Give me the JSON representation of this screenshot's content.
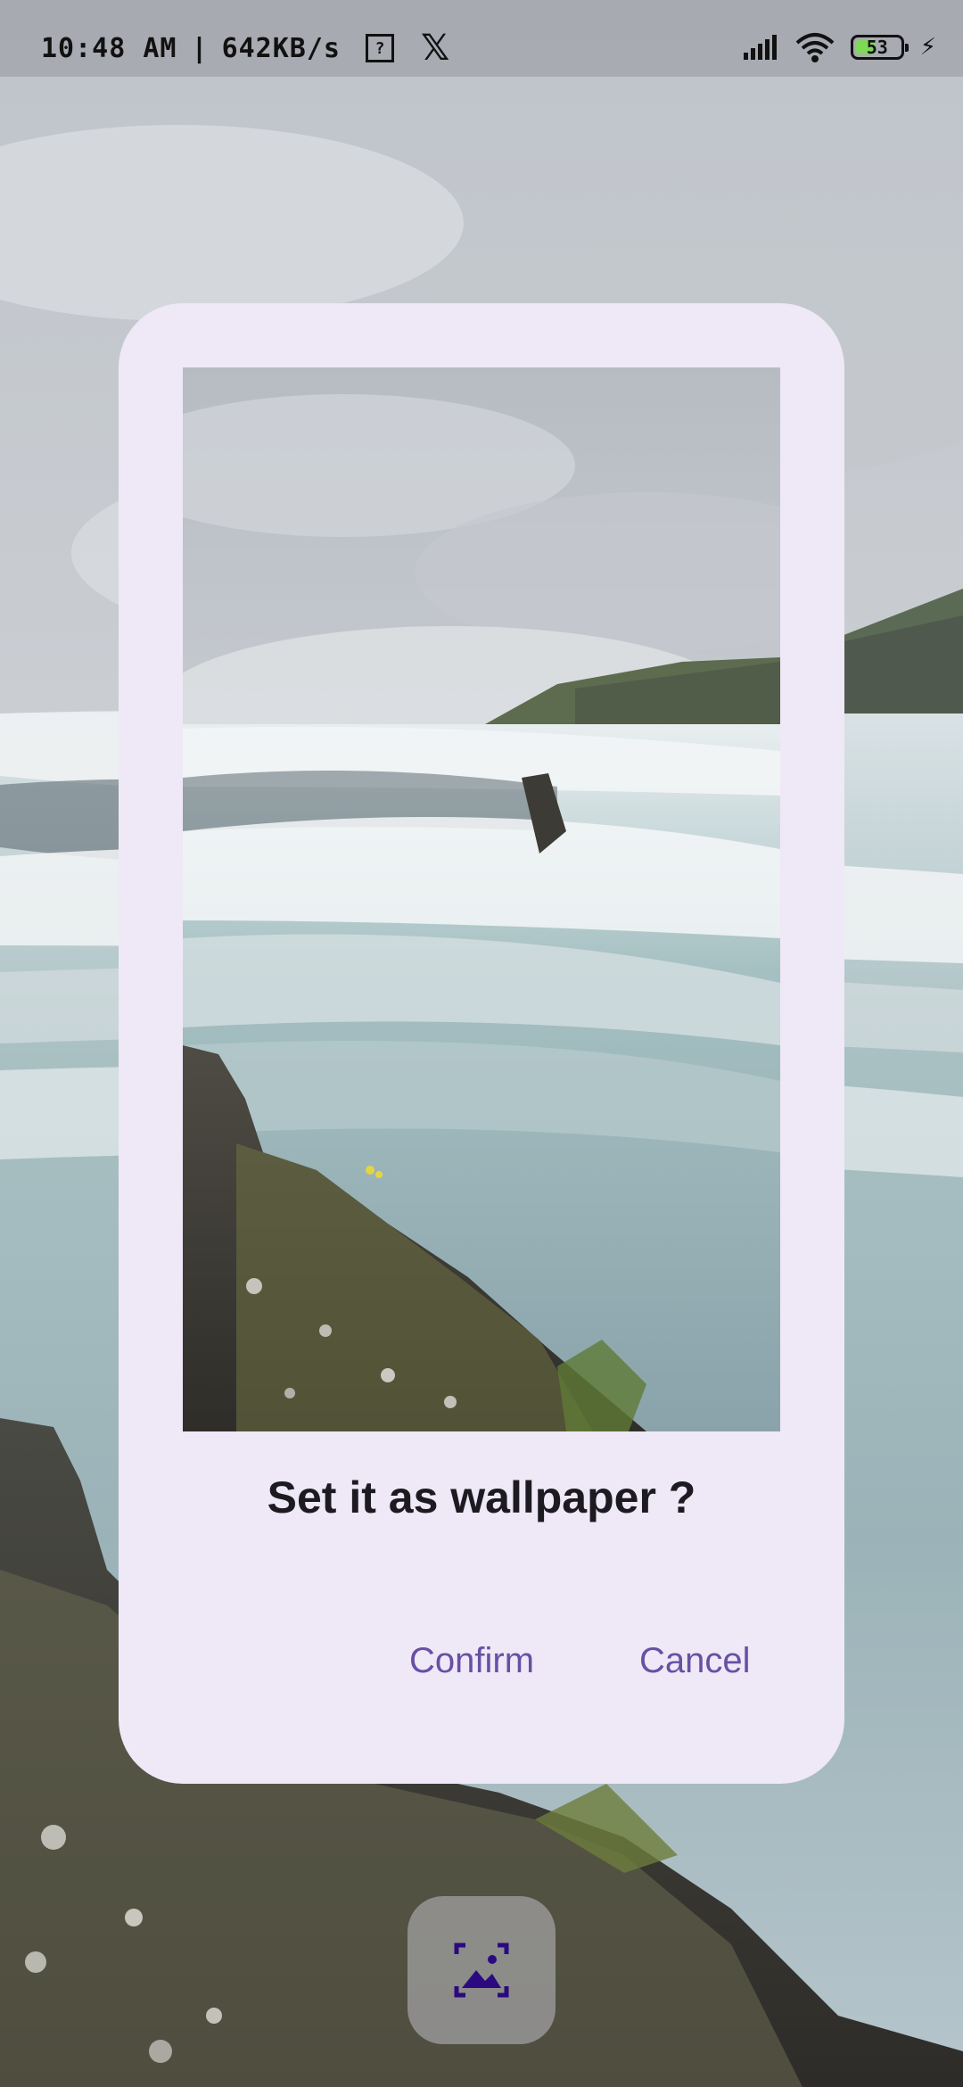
{
  "status_bar": {
    "time": "10:48 AM",
    "separator": "|",
    "network_speed": "642KB/s",
    "notification_icon": "sim-alert-icon",
    "app_icon": "x-logo-icon",
    "signal_icon": "cellular-signal-icon",
    "wifi_icon": "wifi-icon",
    "battery_level": "53",
    "battery_fraction": 0.53,
    "charging_icon": "charging-bolt-icon"
  },
  "dialog": {
    "title": "Set it as wallpaper ?",
    "confirm_label": "Confirm",
    "cancel_label": "Cancel",
    "preview_image": "waterfall-wallpaper-preview"
  },
  "fab": {
    "icon": "wallpaper-image-icon"
  },
  "colors": {
    "dialog_background": "#efe8f6",
    "accent": "#6750a4",
    "title_text": "#1d1b22",
    "icon_accent": "#2b0a80"
  }
}
